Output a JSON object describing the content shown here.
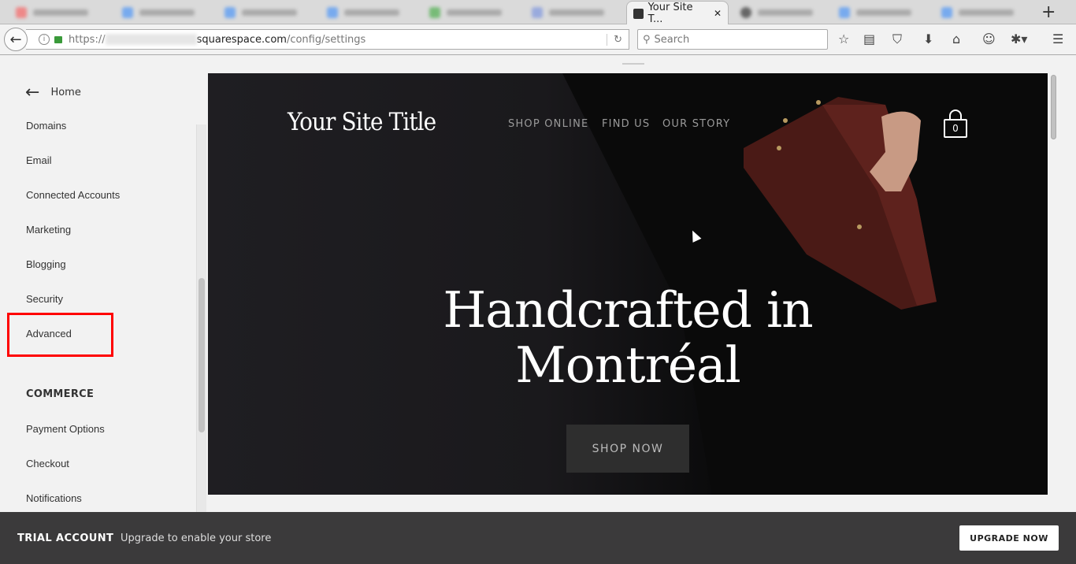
{
  "browser": {
    "active_tab": {
      "title": "Your Site T...",
      "close": "✕"
    },
    "new_tab": "+",
    "url": {
      "scheme": "https://",
      "host": "squarespace.com",
      "path": "/config/settings"
    },
    "search_placeholder": "Search"
  },
  "sidebar": {
    "back_label": "Home",
    "items": [
      {
        "label": "Domains"
      },
      {
        "label": "Email"
      },
      {
        "label": "Connected Accounts"
      },
      {
        "label": "Marketing"
      },
      {
        "label": "Blogging"
      },
      {
        "label": "Security"
      },
      {
        "label": "Advanced",
        "highlighted": true
      }
    ],
    "commerce_heading": "COMMERCE",
    "commerce_items": [
      {
        "label": "Payment Options"
      },
      {
        "label": "Checkout"
      },
      {
        "label": "Notifications"
      }
    ]
  },
  "preview": {
    "site_title": "Your Site Title",
    "nav": [
      "SHOP ONLINE",
      "FIND US",
      "OUR STORY"
    ],
    "cart_count": "0",
    "headline_line1": "Handcrafted in",
    "headline_line2": "Montréal",
    "cta": "SHOP NOW"
  },
  "bottom_bar": {
    "label": "TRIAL ACCOUNT",
    "message": "Upgrade to enable your store",
    "button": "UPGRADE NOW"
  },
  "colors": {
    "highlight": "#ff0000",
    "bottom_bar": "#3b3a3b"
  }
}
